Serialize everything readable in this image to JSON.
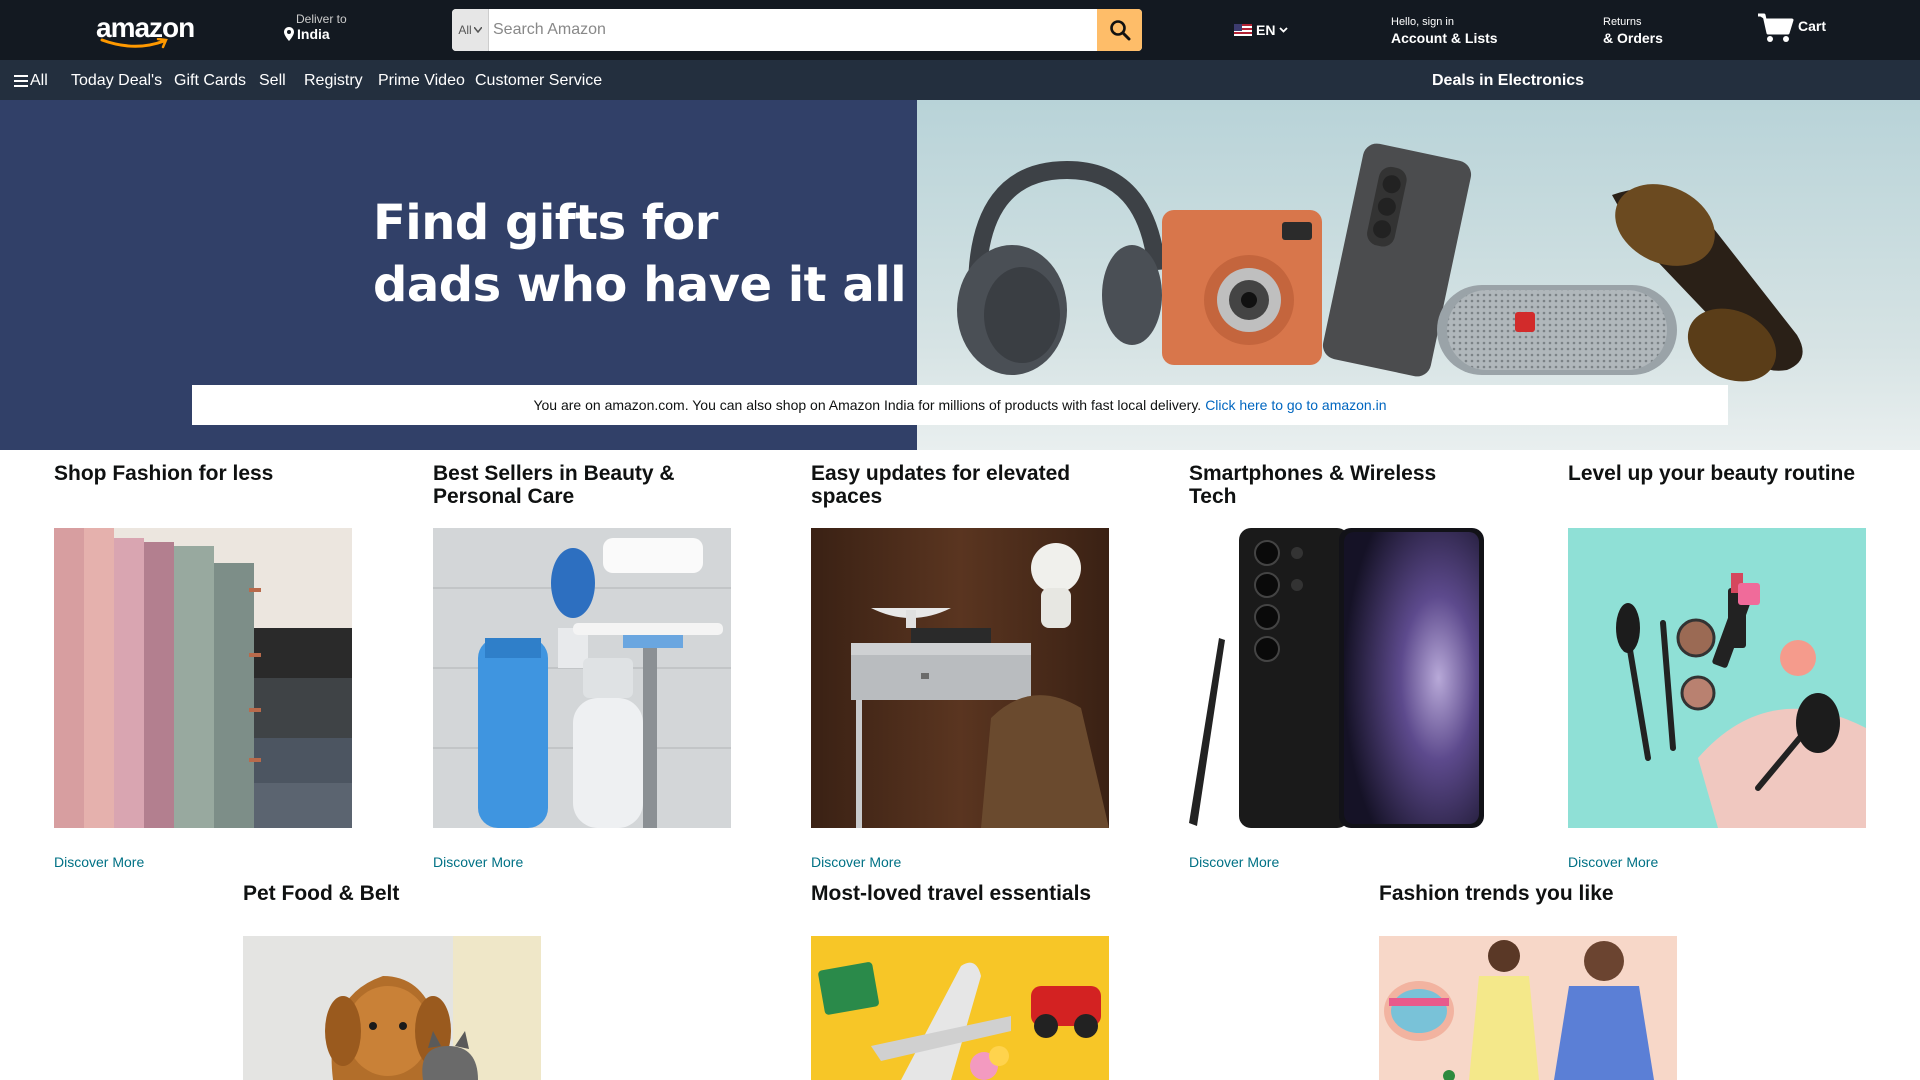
{
  "header": {
    "logo_text": "amazon",
    "deliver_label": "Deliver to",
    "deliver_location": "India",
    "search_category": "All",
    "search_placeholder": "Search Amazon",
    "language": "EN",
    "account_greeting": "Hello, sign in",
    "account_label": "Account & Lists",
    "returns_label": "Returns",
    "orders_label": "& Orders",
    "cart_label": "Cart",
    "colors": {
      "bg": "#131921",
      "search_button": "#febd69",
      "logo_smile": "#ff9900"
    }
  },
  "nav": {
    "all_label": "All",
    "items": [
      "Today Deal's",
      "Gift Cards",
      "Sell",
      "Registry",
      "Prime Video",
      "Customer Service"
    ],
    "promo": "Deals in Electronics",
    "colors": {
      "bg": "#232f3e"
    }
  },
  "hero": {
    "title_line1": "Find gifts for",
    "title_line2": "dads who have it all",
    "notice_text": "You are on amazon.com. You can also shop on Amazon India for millions of products with fast local delivery.",
    "notice_link": "Click here to go to amazon.in",
    "colors": {
      "left_bg": "#314068"
    }
  },
  "cards_row1": [
    {
      "title": "Shop Fashion for less",
      "link": "Discover More",
      "image": "folded-fabrics"
    },
    {
      "title": "Best Sellers in Beauty & Personal Care",
      "link": "Discover More",
      "image": "toiletries"
    },
    {
      "title": "Easy updates for elevated spaces",
      "link": "Discover More",
      "image": "desk-furniture"
    },
    {
      "title": "Smartphones & Wireless Tech",
      "link": "Discover More",
      "image": "smartphone"
    },
    {
      "title": "Level up your beauty routine",
      "link": "Discover More",
      "image": "makeup"
    }
  ],
  "cards_row2": [
    {
      "title": "Pet Food & Belt",
      "image": "dog-and-cat"
    },
    {
      "title": "Most-loved travel essentials",
      "image": "toy-airplane"
    },
    {
      "title": "Fashion trends you like",
      "image": "fashion-models"
    }
  ]
}
